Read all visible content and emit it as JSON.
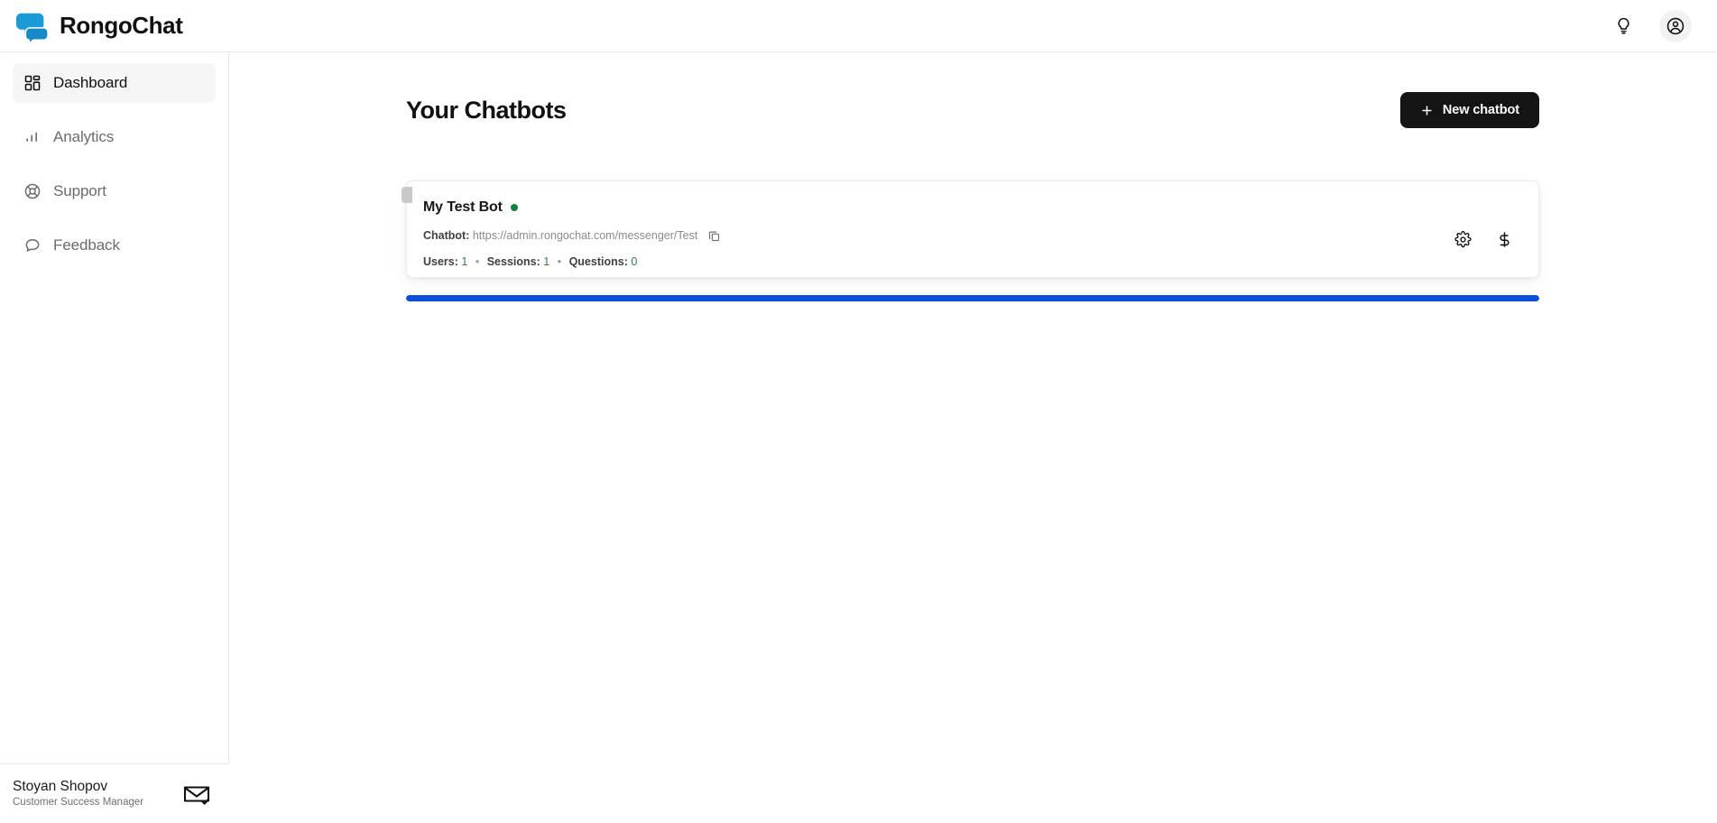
{
  "brand": {
    "name": "RongoChat",
    "logo_icon": "chat-bubbles-icon",
    "logo_color": "#1a9ad6"
  },
  "topbar": {
    "actions": [
      {
        "icon": "lightbulb-icon",
        "name": "tips-button"
      },
      {
        "icon": "user-circle-icon",
        "name": "account-button"
      }
    ]
  },
  "sidebar": {
    "items": [
      {
        "label": "Dashboard",
        "icon": "grid-icon",
        "active": true
      },
      {
        "label": "Analytics",
        "icon": "bar-chart-icon",
        "active": false
      },
      {
        "label": "Support",
        "icon": "lifebuoy-icon",
        "active": false
      },
      {
        "label": "Feedback",
        "icon": "speech-bubble-icon",
        "active": false
      }
    ],
    "footer": {
      "name": "Stoyan Shopov",
      "role": "Customer Success Manager",
      "icon": "mail-check-icon"
    }
  },
  "main": {
    "title": "Your Chatbots",
    "new_chatbot_label": "New chatbot",
    "new_chatbot_icon": "plus-icon",
    "chatbots": [
      {
        "name": "My Test Bot",
        "status": "online",
        "status_color": "#15803d",
        "url_label": "Chatbot:",
        "url": "https://admin.rongochat.com/messenger/Test",
        "copy_icon": "copy-icon",
        "stats": [
          {
            "label": "Users:",
            "value": "1"
          },
          {
            "label": "Sessions:",
            "value": "1"
          },
          {
            "label": "Questions:",
            "value": "0"
          }
        ],
        "separator": "•",
        "actions": [
          {
            "icon": "gear-icon",
            "name": "settings-button"
          },
          {
            "icon": "dollar-icon",
            "name": "billing-button"
          }
        ]
      }
    ],
    "progress": {
      "percent": 100,
      "color": "#0b4fd8"
    }
  }
}
